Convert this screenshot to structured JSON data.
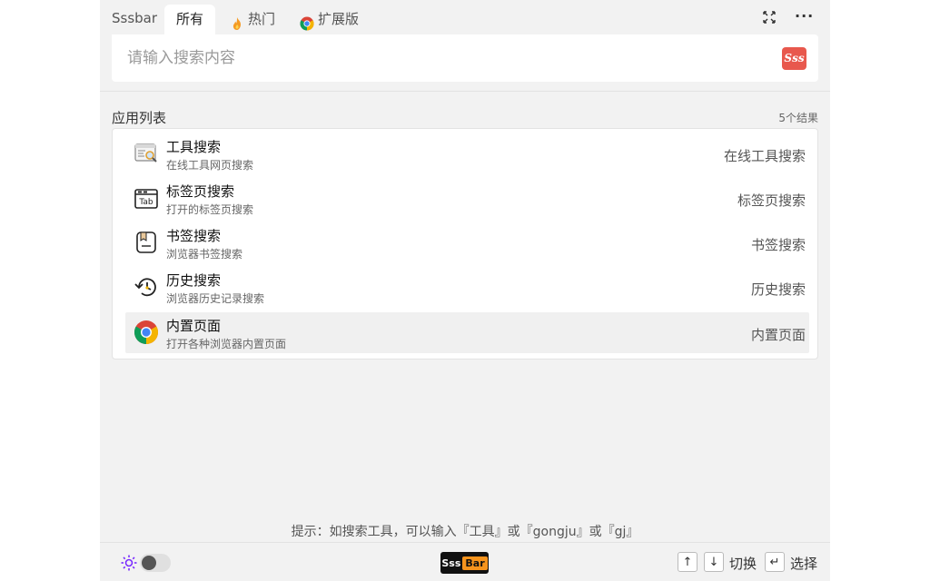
{
  "header": {
    "brand": "Sssbar",
    "tabs": [
      {
        "label": "所有",
        "active": true
      },
      {
        "label": "热门",
        "icon": "fire-icon"
      },
      {
        "label": "扩展版",
        "icon": "chrome-icon"
      }
    ]
  },
  "search": {
    "placeholder": "请输入搜索内容",
    "value": "",
    "logo_text": "Sss"
  },
  "list": {
    "title": "应用列表",
    "count": "5个结果",
    "items": [
      {
        "title": "工具搜索",
        "desc": "在线工具网页搜索",
        "right": "在线工具搜索",
        "icon": "tool-search-icon"
      },
      {
        "title": "标签页搜索",
        "desc": "打开的标签页搜索",
        "right": "标签页搜索",
        "icon": "tab-search-icon",
        "icon_text": "Tab"
      },
      {
        "title": "书签搜索",
        "desc": "浏览器书签搜索",
        "right": "书签搜索",
        "icon": "bookmark-icon"
      },
      {
        "title": "历史搜索",
        "desc": "浏览器历史记录搜索",
        "right": "历史搜索",
        "icon": "history-icon"
      },
      {
        "title": "内置页面",
        "desc": "打开各种浏览器内置页面",
        "right": "内置页面",
        "icon": "chrome-icon",
        "selected": true
      }
    ]
  },
  "hint": "提示：如搜索工具，可以输入『工具』或『gongju』或『gj』",
  "footer": {
    "logo_left": "Sss",
    "logo_right": "Bar",
    "switch_label": "切换",
    "select_label": "选择",
    "key_up": "↑",
    "key_down": "↓",
    "key_enter": "↵"
  },
  "colors": {
    "accent_red": "#e8584d",
    "logo_orange": "#f7941d",
    "sun_purple": "#7b2cff"
  }
}
